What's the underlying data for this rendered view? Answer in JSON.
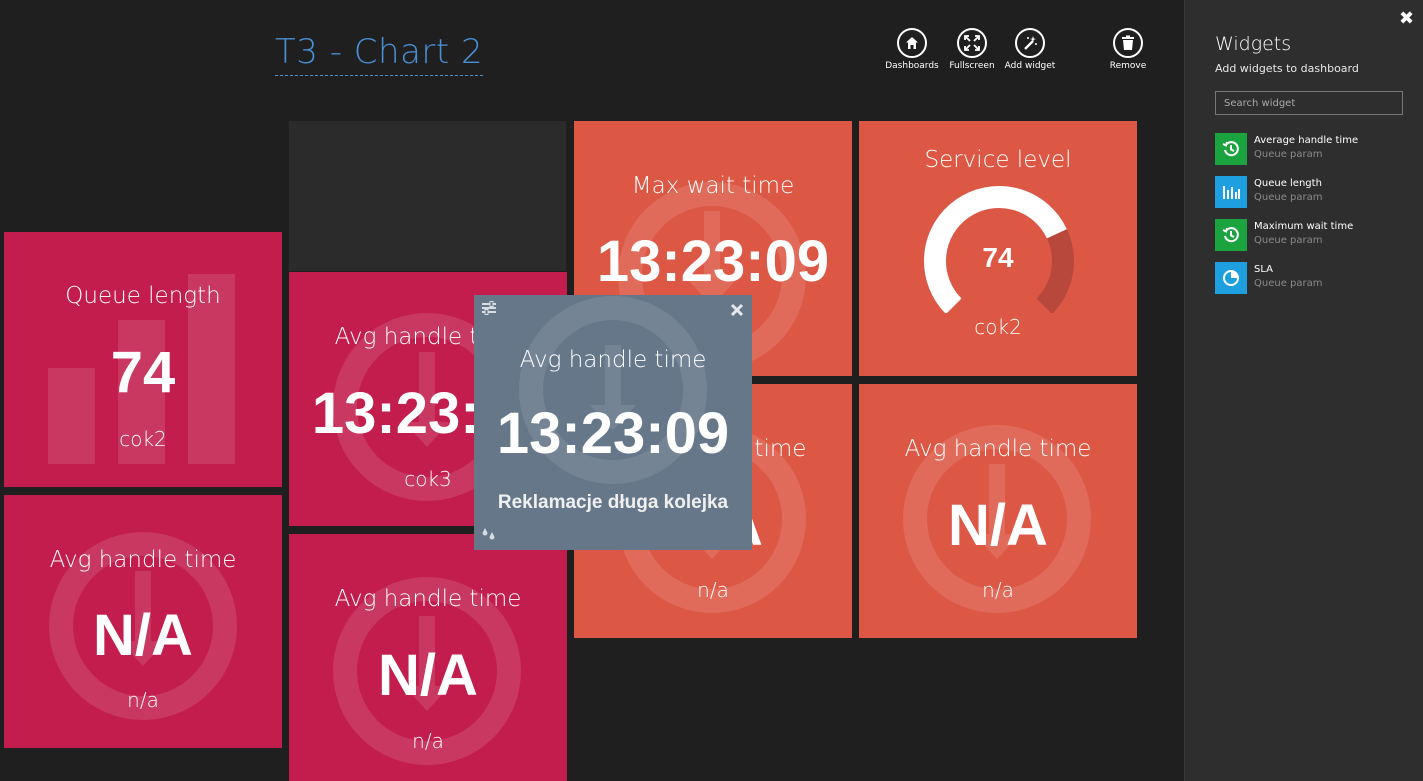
{
  "header": {
    "title": "T3 - Chart 2"
  },
  "toolbar": {
    "dashboards": "Dashboards",
    "fullscreen": "Fullscreen",
    "add_widget": "Add widget",
    "remove": "Remove"
  },
  "tiles": {
    "queue_length": {
      "title": "Queue length",
      "value": "74",
      "sub": "cok2"
    },
    "avg_left_bottom": {
      "title": "Avg handle time",
      "value": "N/A",
      "sub": "n/a"
    },
    "avg_mid_top": {
      "title": "Avg handle time",
      "value": "13:23:09",
      "sub": "cok3"
    },
    "avg_mid_bottom": {
      "title": "Avg handle time",
      "value": "N/A",
      "sub": "n/a"
    },
    "max_wait": {
      "title": "Max wait time",
      "value": "13:23:09"
    },
    "avg_orange_mid": {
      "title": "Avg handle time",
      "value": "N/A",
      "sub": "n/a"
    },
    "service_level": {
      "title": "Service level",
      "value": "74",
      "sub": "cok2",
      "gauge_fraction": 0.74
    },
    "avg_orange_right": {
      "title": "Avg handle time",
      "value": "N/A",
      "sub": "n/a"
    }
  },
  "popup": {
    "title": "Avg handle time",
    "value": "13:23:09",
    "description": "Reklamacje długa kolejka"
  },
  "panel": {
    "title": "Widgets",
    "subtitle": "Add widgets to dashboard",
    "search_placeholder": "Search widget",
    "items": [
      {
        "name": "Average handle time",
        "type": "Queue param",
        "icon": "history-icon",
        "color": "#1aa33f"
      },
      {
        "name": "Queue length",
        "type": "Queue param",
        "icon": "bar-chart-icon",
        "color": "#1e9fe0"
      },
      {
        "name": "Maximum wait time",
        "type": "Queue param",
        "icon": "history-icon",
        "color": "#1aa33f"
      },
      {
        "name": "SLA",
        "type": "Queue param",
        "icon": "pie-chart-icon",
        "color": "#1e9fe0"
      }
    ]
  },
  "colors": {
    "crimson": "#c21d4c",
    "orange": "#dc5744",
    "popup": "#66778a",
    "title_blue": "#4a8fd6"
  }
}
